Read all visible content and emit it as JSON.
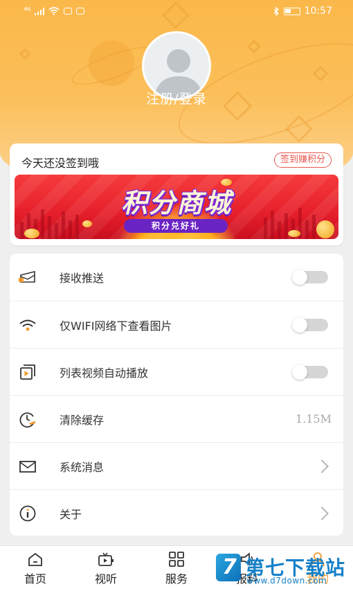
{
  "status_bar": {
    "network": "⁴⁶",
    "signal_icon": "signal-icon",
    "wifi_icon": "wifi-icon",
    "bluetooth_icon": "bluetooth-icon",
    "battery_icon": "battery-icon",
    "time": "10:57"
  },
  "profile": {
    "avatar_icon": "default-avatar-icon",
    "login_label": "注册/登录"
  },
  "signin": {
    "prompt": "今天还没签到哦",
    "button_label": "签到赚积分"
  },
  "banner": {
    "title": "积分商城",
    "subtitle": "积分兑好礼"
  },
  "settings": [
    {
      "icon": "envelope-push-icon",
      "label": "接收推送",
      "control": "toggle",
      "state": "off"
    },
    {
      "icon": "wifi-icon",
      "label": "仅WIFI网络下查看图片",
      "control": "toggle",
      "state": "off"
    },
    {
      "icon": "video-play-icon",
      "label": "列表视频自动播放",
      "control": "toggle",
      "state": "off"
    },
    {
      "icon": "clock-clear-icon",
      "label": "清除缓存",
      "control": "value",
      "value": "1.15M"
    },
    {
      "icon": "mail-icon",
      "label": "系统消息",
      "control": "chevron"
    },
    {
      "icon": "info-icon",
      "label": "关于",
      "control": "chevron"
    }
  ],
  "tabbar": {
    "items": [
      {
        "label": "首页",
        "icon": "home-icon"
      },
      {
        "label": "视听",
        "icon": "tv-icon"
      },
      {
        "label": "服务",
        "icon": "grid-icon"
      },
      {
        "label": "报料",
        "icon": "megaphone-icon"
      },
      {
        "label": "我的",
        "icon": "person-icon",
        "active": true
      }
    ]
  },
  "watermark": {
    "title": "第七下载站",
    "url": "www.d7down.com"
  },
  "colors": {
    "header": "#fbb84a",
    "accent": "#f29a2e",
    "signin_button": "#e8584e",
    "banner": "#e61f2b",
    "toggle_off": "#d6d6d6"
  }
}
